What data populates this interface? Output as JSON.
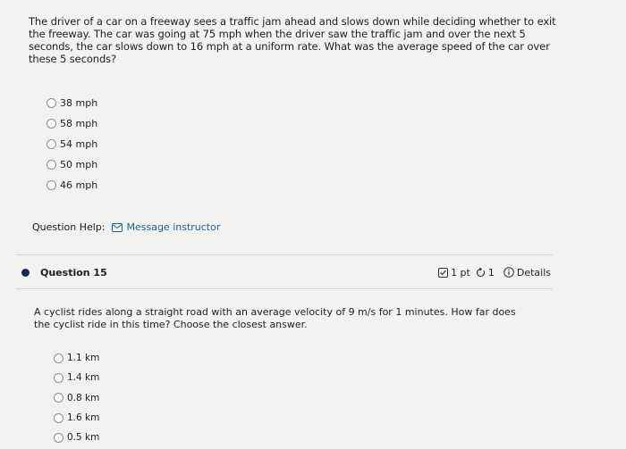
{
  "question1": {
    "text": "The driver of a car on a freeway sees a traffic jam ahead and slows down while deciding whether to exit the freeway. The car was going at 75 mph when the driver saw the traffic jam and over the next 5 seconds, the car slows down to 16 mph at a uniform rate. What was the average speed of the car over these 5 seconds?",
    "options": [
      "38 mph",
      "58 mph",
      "54 mph",
      "50 mph",
      "46 mph"
    ]
  },
  "help": {
    "label": "Question Help:",
    "message_label": "Message instructor"
  },
  "question15": {
    "title": "Question 15",
    "points": "1 pt",
    "attempts": "1",
    "details_label": "Details",
    "text": "A cyclist rides along a straight road with an average velocity of 9 m/s for 1 minutes. How far does the cyclist ride in this time? Choose the closest answer.",
    "options": [
      "1.1 km",
      "1.4 km",
      "0.8 km",
      "1.6 km",
      "0.5 km"
    ]
  },
  "colors": {
    "link": "#2c5d8f",
    "bullet": "#1b2a4a",
    "background": "#f2f2f0"
  }
}
